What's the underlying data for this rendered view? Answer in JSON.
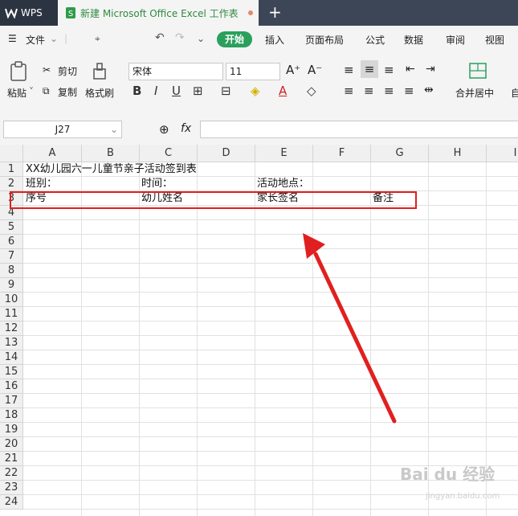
{
  "titlebar": {
    "app_label": "WPS",
    "doc_title": "新建 Microsoft Office Excel 工作表",
    "new_tab": "+"
  },
  "menu": {
    "file_label": "文件",
    "tabs": [
      "开始",
      "插入",
      "页面布局",
      "公式",
      "数据",
      "审阅",
      "视图"
    ]
  },
  "toolbar": {
    "paste_label": "粘贴",
    "cut_label": "剪切",
    "copy_label": "复制",
    "format_painter_label": "格式刷",
    "font_name": "宋体",
    "font_size": "11",
    "merge_label": "合并居中",
    "font_grow": "A⁺",
    "font_shrink": "A⁻",
    "bold": "B",
    "italic": "I",
    "underline": "U",
    "font_color_letter": "A",
    "auto_label": "自"
  },
  "formula_bar": {
    "name_box": "J27",
    "fx_label": "fx",
    "value": ""
  },
  "grid": {
    "columns": [
      "A",
      "B",
      "C",
      "D",
      "E",
      "F",
      "G",
      "H",
      "I"
    ],
    "rows": [
      "1",
      "2",
      "3",
      "4",
      "5",
      "6",
      "7",
      "8",
      "9",
      "10",
      "11",
      "12",
      "13",
      "14",
      "15",
      "16",
      "17",
      "18",
      "19",
      "20",
      "21",
      "22",
      "23",
      "24"
    ],
    "cells": {
      "A1": "XX幼儿园六一儿童节亲子活动签到表",
      "A2": "班别：",
      "C2": "时间：",
      "E2": "活动地点：",
      "A3": "序号",
      "C3": "幼儿姓名",
      "E3": "家长签名",
      "G3": "备注"
    }
  },
  "watermark": {
    "text": "Bai du 经验",
    "sub": "jingyan.baidu.com"
  },
  "colors": {
    "accent_green": "#2aa05c",
    "highlight_red": "#e02020",
    "titlebar_bg": "#3d4656"
  }
}
